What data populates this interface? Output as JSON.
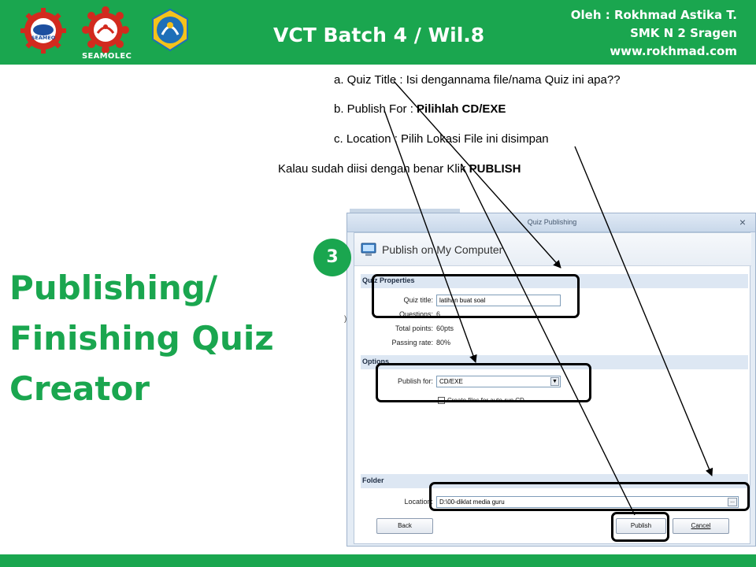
{
  "header": {
    "title": "VCT Batch 4 / Wil.8",
    "credit_line1": "Oleh : Rokhmad  Astika T.",
    "credit_line2": "SMK N 2 Sragen",
    "credit_line3": "www.rokhmad.com",
    "logo_seameo_text": "SEAMEO",
    "logo_seamolec_caption": "SEAMOLEC",
    "brand_color": "#1aa64f"
  },
  "instructions": {
    "a_prefix": "a. Quiz Title : Isi dengannama file/nama Quiz ini apa??",
    "b_prefix": "b. Publish For : ",
    "b_bold": "Pilihlah CD/EXE",
    "c_text": "c. Location : Pilih Lokasi File ini disimpan",
    "final_prefix": "Kalau sudah diisi dengan benar Klik ",
    "final_bold": "PUBLISH"
  },
  "slide_title": {
    "line1": "Publishing/",
    "line2": "Finishing Quiz",
    "line3": "Creator"
  },
  "step_badge": "3",
  "dialog": {
    "window_title": "Quiz Publishing",
    "close_glyph": "×",
    "heading": "Publish on My Computer",
    "sections": {
      "quiz_properties": "Quiz Properties",
      "options": "Options",
      "folder": "Folder"
    },
    "quiz_title_label": "Quiz title:",
    "quiz_title_value": "latihan buat soal",
    "questions_label": "Questions:",
    "questions_value": "6",
    "total_points_label": "Total points:",
    "total_points_value": "60pts",
    "passing_rate_label": "Passing rate:",
    "passing_rate_value": "80%",
    "publish_for_label": "Publish for:",
    "publish_for_value": "CD/EXE",
    "autorun_label": "Create files for auto-run CD",
    "location_label": "Location:",
    "location_value": "D:\\00-diklat media guru",
    "browse_label": "...",
    "back_button": "Back",
    "publish_button": "Publish",
    "cancel_button": "Cancel"
  },
  "icons": [
    "seameo-logo",
    "seamolec-logo",
    "tutwuri-logo",
    "computer-icon",
    "dropdown-arrow-icon",
    "close-icon"
  ]
}
